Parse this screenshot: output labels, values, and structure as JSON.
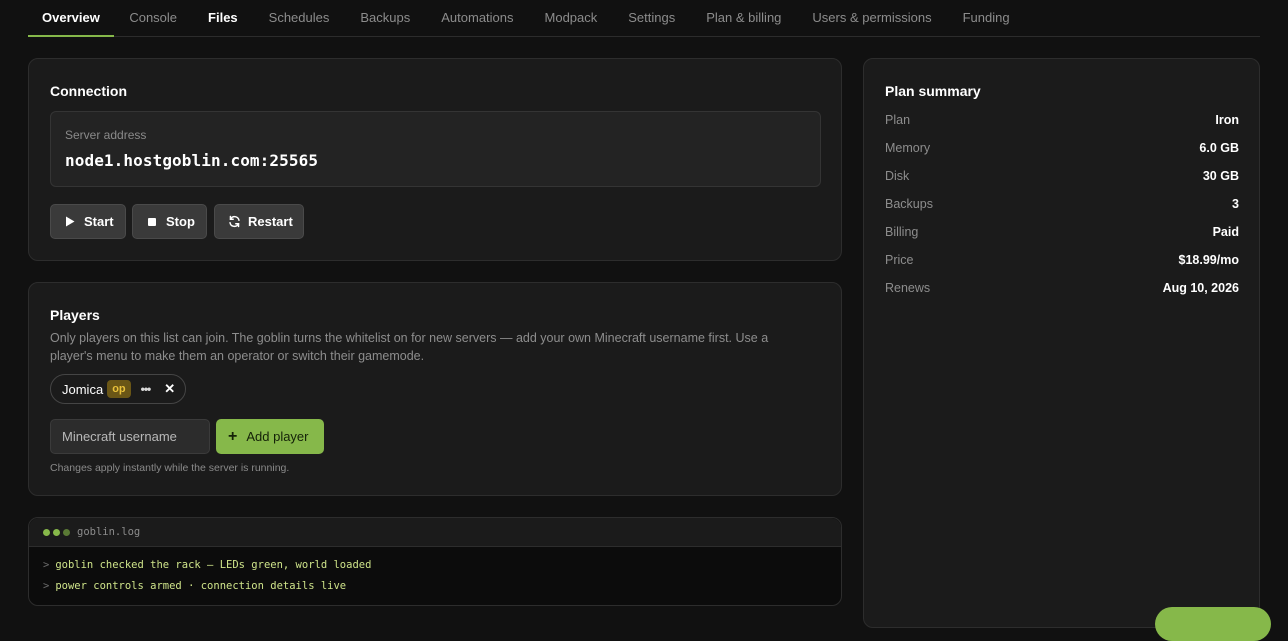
{
  "tabs": [
    {
      "label": "Overview"
    },
    {
      "label": "Console"
    },
    {
      "label": "Files"
    },
    {
      "label": "Schedules"
    },
    {
      "label": "Backups"
    },
    {
      "label": "Automations"
    },
    {
      "label": "Modpack"
    },
    {
      "label": "Settings"
    },
    {
      "label": "Plan & billing"
    },
    {
      "label": "Users & permissions"
    },
    {
      "label": "Funding"
    }
  ],
  "connection": {
    "title": "Connection",
    "address_label": "Server address",
    "address": "node1.hostgoblin.com:25565",
    "start_label": "Start",
    "stop_label": "Stop",
    "restart_label": "Restart"
  },
  "players": {
    "title": "Players",
    "description": "Only players on this list can join. The goblin turns the whitelist on for new servers — add your own Minecraft username first. Use a player's menu to make them an operator or switch their gamemode.",
    "list": [
      {
        "name": "Jomica",
        "badge": "op"
      }
    ],
    "input_placeholder": "Minecraft username",
    "add_label": "Add player",
    "note": "Changes apply instantly while the server is running."
  },
  "log": {
    "title": "goblin.log",
    "prompt": ">",
    "lines": [
      "goblin checked the rack — LEDs green, world loaded",
      "power controls armed · connection details live"
    ],
    "dot_colors": [
      "#86b84a",
      "#86b84a",
      "#5a7a35"
    ]
  },
  "plan": {
    "title": "Plan summary",
    "rows": [
      {
        "key": "Plan",
        "value": "Iron"
      },
      {
        "key": "Memory",
        "value": "6.0 GB"
      },
      {
        "key": "Disk",
        "value": "30 GB"
      },
      {
        "key": "Backups",
        "value": "3"
      },
      {
        "key": "Billing",
        "value": "Paid"
      },
      {
        "key": "Price",
        "value": "$18.99/mo"
      },
      {
        "key": "Renews",
        "value": "Aug 10, 2026"
      }
    ]
  },
  "colors": {
    "accent": "#86b84a",
    "background": "#111111",
    "card": "#1b1b1b",
    "op_badge": "#6a5616"
  },
  "icons": [
    "play-icon",
    "stop-icon",
    "refresh-icon",
    "more-icon",
    "close-icon",
    "plus-icon"
  ]
}
